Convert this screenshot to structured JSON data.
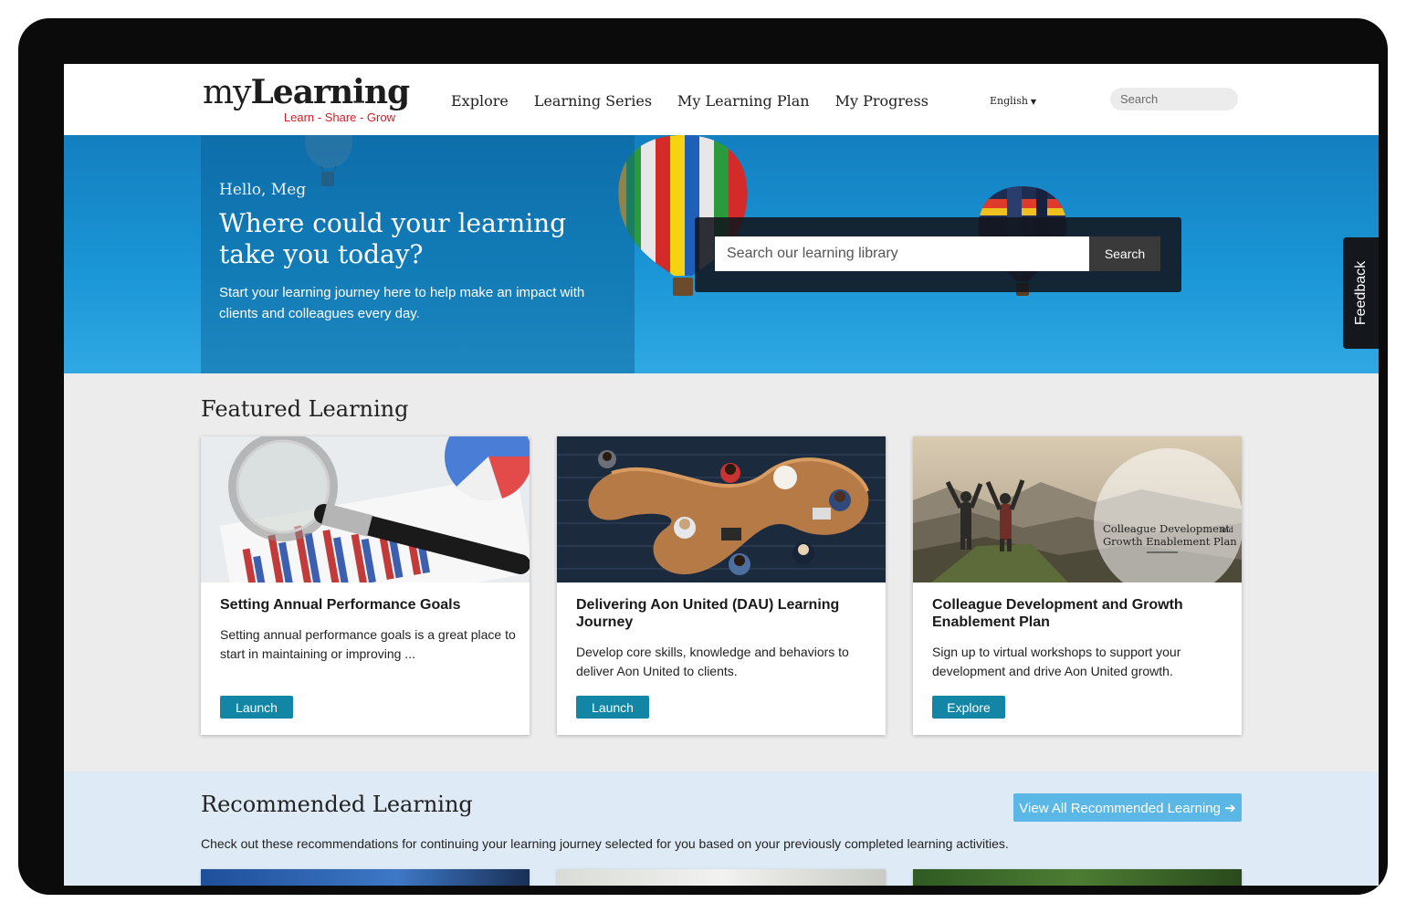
{
  "header": {
    "logo_main_light": "my",
    "logo_main_bold": "Learning",
    "logo_tagline": "Learn - Share - Grow",
    "nav": [
      "Explore",
      "Learning Series",
      "My Learning Plan",
      "My Progress"
    ],
    "language": "English",
    "search_placeholder": "Search"
  },
  "hero": {
    "greeting": "Hello, Meg",
    "title": "Where could your learning take you today?",
    "subtitle": "Start your learning journey here to help make an impact with clients and colleagues every day.",
    "search_placeholder": "Search our learning library",
    "search_button": "Search"
  },
  "feedback_label": "Feedback",
  "featured": {
    "title": "Featured Learning",
    "cards": [
      {
        "title": "Setting Annual Performance Goals",
        "description": "Setting annual performance goals is a great place to start in maintaining or improving ...",
        "button": "Launch"
      },
      {
        "title": "Delivering Aon United (DAU) Learning Journey",
        "description": "Develop core skills, knowledge and behaviors to deliver Aon United to clients.",
        "button": "Launch"
      },
      {
        "title": "Colleague Development and Growth Enablement Plan",
        "description": "Sign up to virtual workshops to support your development and drive Aon United growth.",
        "button": "Explore",
        "image_caption_line1": "Colleague Development",
        "image_caption_and": "and",
        "image_caption_line2": "Growth Enablement Plan"
      }
    ]
  },
  "recommended": {
    "title": "Recommended Learning",
    "view_all_button": "View All Recommended Learning",
    "description": "Check out these recommendations for continuing your learning journey selected for you based on your previously completed learning activities."
  },
  "colors": {
    "brand_red": "#d21f26",
    "button_teal": "#1486a5",
    "view_all_blue": "#5bb7e6",
    "hero_blue": "#1a95d5"
  }
}
